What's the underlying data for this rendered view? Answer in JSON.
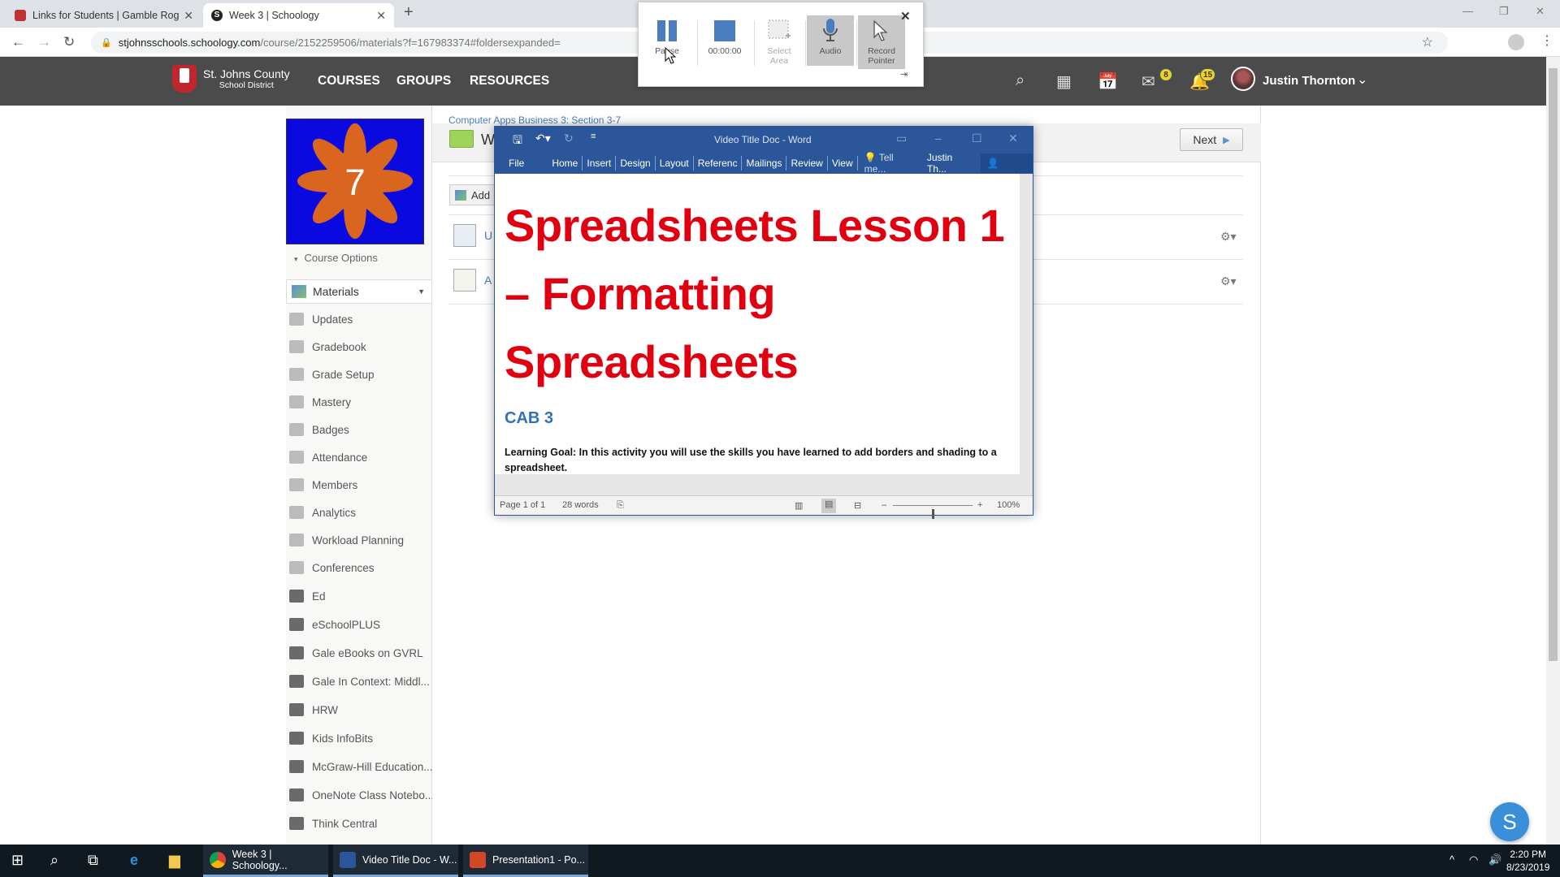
{
  "browser": {
    "tabs": [
      {
        "title": "Links for Students | Gamble Rog",
        "active": false
      },
      {
        "title": "Week 3 | Schoology",
        "active": true
      }
    ],
    "url_host": "stjohnsschools.schoology.com",
    "url_path": "/course/2152259506/materials?f=167983374#foldersexpanded="
  },
  "recorder": {
    "pause_label": "Pause",
    "timer": "00:00:00",
    "select_area_label_1": "Select",
    "select_area_label_2": "Area",
    "audio_label": "Audio",
    "record_pointer_label_1": "Record",
    "record_pointer_label_2": "Pointer"
  },
  "header": {
    "district_line1": "St. Johns County",
    "district_line2": "School District",
    "nav": [
      "COURSES",
      "GROUPS",
      "RESOURCES"
    ],
    "messages_count": "8",
    "notifications_count": "15",
    "user_name": "Justin Thornton"
  },
  "course": {
    "image_number": "7",
    "options_label": "Course Options",
    "materials_label": "Materials",
    "sidebar": [
      "Updates",
      "Gradebook",
      "Grade Setup",
      "Mastery",
      "Badges",
      "Attendance",
      "Members",
      "Analytics",
      "Workload Planning",
      "Conferences",
      "Ed",
      "eSchoolPLUS",
      "Gale eBooks on GVRL",
      "Gale In Context: Middl...",
      "HRW",
      "Kids InfoBits",
      "McGraw-Hill Education...",
      "OneNote Class Notebo...",
      "Think Central"
    ]
  },
  "content": {
    "breadcrumb": "Computer Apps Business 3: Section 3-7",
    "folder_title": "W",
    "next_label": "Next",
    "add_label": "Add",
    "items": [
      "U",
      "A"
    ]
  },
  "word": {
    "caption": "Video Title Doc - Word",
    "ribbon_tabs": [
      "Home",
      "Insert",
      "Design",
      "Layout",
      "Referenc",
      "Mailings",
      "Review",
      "View"
    ],
    "file_label": "File",
    "tell_me": "Tell me...",
    "user": "Justin Th...",
    "share_label": "Share",
    "doc_title": "Spreadsheets Lesson 1 – Formatting Spreadsheets",
    "doc_subtitle": "CAB 3",
    "doc_goal": "Learning Goal:  In this activity you will use the skills you have learned to add borders and shading to a spreadsheet.",
    "page_info": "Page 1 of 1",
    "word_count": "28 words",
    "zoom_level": "100%",
    "zoom_fraction": 0.5
  },
  "taskbar": {
    "apps": [
      "Week 3 | Schoology...",
      "Video Title Doc - W...",
      "Presentation1 - Po..."
    ],
    "time": "2:20 PM",
    "date": "8/23/2019"
  },
  "chat_label": "S"
}
